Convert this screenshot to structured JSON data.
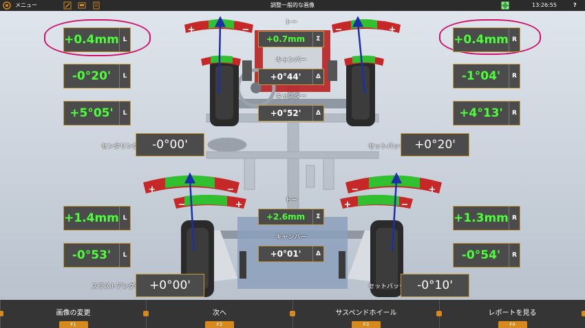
{
  "topbar": {
    "menu": "メニュー",
    "title": "調整一般的な画像",
    "time": "13:26:55",
    "help": "?"
  },
  "front": {
    "toe_l": {
      "value": "+0.4mm",
      "side": "L"
    },
    "toe_r": {
      "value": "+0.4mm",
      "side": "R"
    },
    "camber_l": {
      "value": "-0°20'",
      "side": "L"
    },
    "camber_r": {
      "value": "-1°04'",
      "side": "R"
    },
    "caster_l": {
      "value": "+5°05'",
      "side": "L"
    },
    "caster_r": {
      "value": "+4°13'",
      "side": "R"
    },
    "centering_label": "センタリング",
    "centering_value": "-0°00'",
    "setback_label": "セットバック",
    "setback_value": "+0°20'",
    "center_toe_label": "トー",
    "center_toe_value": "+0.7mm",
    "center_toe_sym": "Σ",
    "center_camber_label": "キャンバー",
    "center_camber_value": "+0°44'",
    "center_camber_sym": "Δ",
    "center_caster_label": "キャスター",
    "center_caster_value": "+0°52'",
    "center_caster_sym": "Δ"
  },
  "rear": {
    "toe_l": {
      "value": "+1.4mm",
      "side": "L"
    },
    "toe_r": {
      "value": "+1.3mm",
      "side": "R"
    },
    "camber_l": {
      "value": "-0°53'",
      "side": "L"
    },
    "camber_r": {
      "value": "-0°54'",
      "side": "R"
    },
    "thrust_label": "スラストアングル",
    "thrust_value": "+0°00'",
    "setback_label": "セットバック",
    "setback_value": "-0°10'",
    "center_toe_label": "トー",
    "center_toe_value": "+2.6mm",
    "center_toe_sym": "Σ",
    "center_camber_label": "キャンバー",
    "center_camber_value": "+0°01'",
    "center_camber_sym": "Δ"
  },
  "gauge": {
    "plus": "+",
    "minus": "−"
  },
  "bottombar": [
    {
      "label": "画像の変更",
      "key": "F1"
    },
    {
      "label": "次へ",
      "key": "F2"
    },
    {
      "label": "サスペンドホイール",
      "key": "F3"
    },
    {
      "label": "レポートを見る",
      "key": "F4"
    }
  ],
  "colors": {
    "value_green": "#4cff3a",
    "box_bg": "#4b4b4b",
    "accent": "#d6891c",
    "annotation": "#d0106a"
  }
}
